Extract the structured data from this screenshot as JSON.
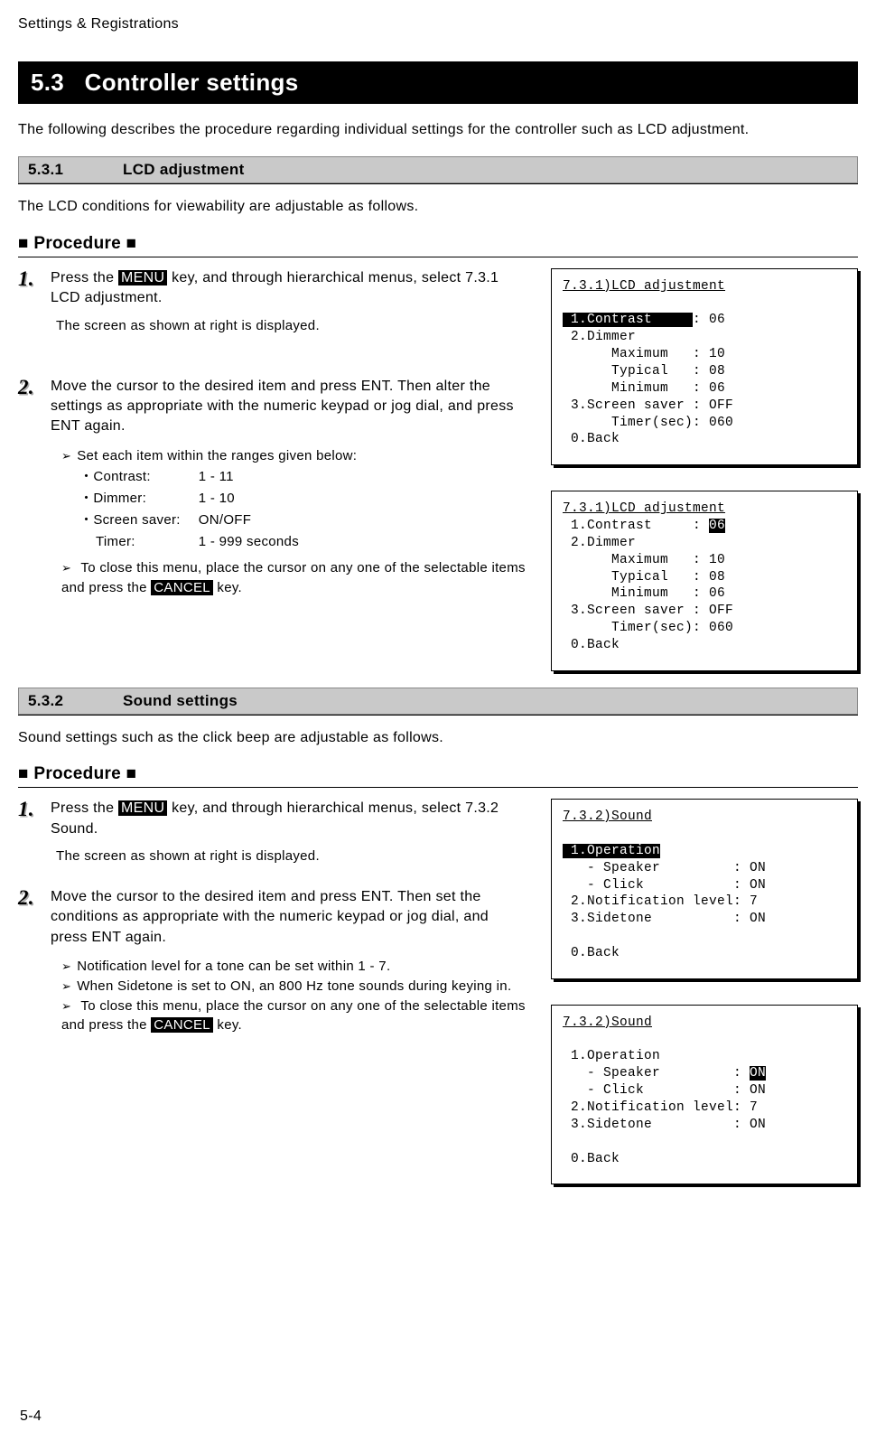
{
  "header": "Settings & Registrations",
  "section": {
    "number": "5.3",
    "title": "Controller settings"
  },
  "intro": "The following describes the procedure regarding individual settings for the controller such as LCD adjustment.",
  "sub1": {
    "number": "5.3.1",
    "title": "LCD adjustment"
  },
  "sub1_intro": "The LCD conditions for viewability are adjustable as follows.",
  "procedure_label": "■ Procedure ■",
  "menu_key": "MENU",
  "cancel_key": "CANCEL",
  "step1a_pre": "Press the ",
  "step1a_post": " key, and through hierarchical menus, select 7.3.1 LCD adjustment.",
  "shown_note": "The screen as shown at right is displayed.",
  "step2a": "Move the cursor to the desired item and press ENT. Then alter the settings as appropriate with the numeric keypad or jog dial, and press ENT again.",
  "ranges_lead": "Set each item within the ranges given below:",
  "ranges": {
    "contrast_label": "Contrast:",
    "contrast_val": "1 - 11",
    "dimmer_label": "Dimmer:",
    "dimmer_val": "1 - 10",
    "saver_label": "Screen saver:",
    "saver_val": "ON/OFF",
    "timer_label": "Timer:",
    "timer_val": "1 - 999 seconds"
  },
  "close_pre": "To close this menu, place the cursor on any one of the selectable items and press the ",
  "close_post": " key.",
  "lcd1": {
    "title": "7.3.1)LCD adjustment",
    "l1a": " 1.Contrast     ",
    "l1b": ": 06",
    "l2": " 2.Dimmer",
    "l3": "      Maximum   : 10",
    "l4": "      Typical   : 08",
    "l5": "      Minimum   : 06",
    "l6": " 3.Screen saver : OFF",
    "l7": "      Timer(sec): 060",
    "l8": " 0.Back"
  },
  "lcd2": {
    "title": "7.3.1)LCD adjustment",
    "l1": " 1.Contrast     : ",
    "l1v": "06",
    "l2": " 2.Dimmer",
    "l3": "      Maximum   : 10",
    "l4": "      Typical   : 08",
    "l5": "      Minimum   : 06",
    "l6": " 3.Screen saver : OFF",
    "l7": "      Timer(sec): 060",
    "l8": " 0.Back"
  },
  "sub2": {
    "number": "5.3.2",
    "title": "Sound settings"
  },
  "sub2_intro": "Sound settings such as the click beep are adjustable as follows.",
  "step1b_post": " key, and through hierarchical menus, select 7.3.2 Sound.",
  "step2b": "Move the cursor to the desired item and press ENT. Then set the conditions as appropriate with the numeric keypad or jog dial, and press ENT again.",
  "note_b1": "Notification level for a tone can be set within 1 - 7.",
  "note_b2": "When Sidetone is set to ON, an 800 Hz tone sounds during keying in.",
  "lcd3": {
    "title": "7.3.2)Sound",
    "l1a": " 1.Operation",
    "l2": "   - Speaker         : ON",
    "l3": "   - Click           : ON",
    "l4": " 2.Notification level: 7",
    "l5": " 3.Sidetone          : ON",
    "l6": "",
    "l7": " 0.Back"
  },
  "lcd4": {
    "title": "7.3.2)Sound",
    "l1": " 1.Operation",
    "l2a": "   - Speaker         : ",
    "l2v": "ON",
    "l3": "   - Click           : ON",
    "l4": " 2.Notification level: 7",
    "l5": " 3.Sidetone          : ON",
    "l6": "",
    "l7": " 0.Back"
  },
  "page_number": "5-4",
  "num1": "1.",
  "num2": "2."
}
